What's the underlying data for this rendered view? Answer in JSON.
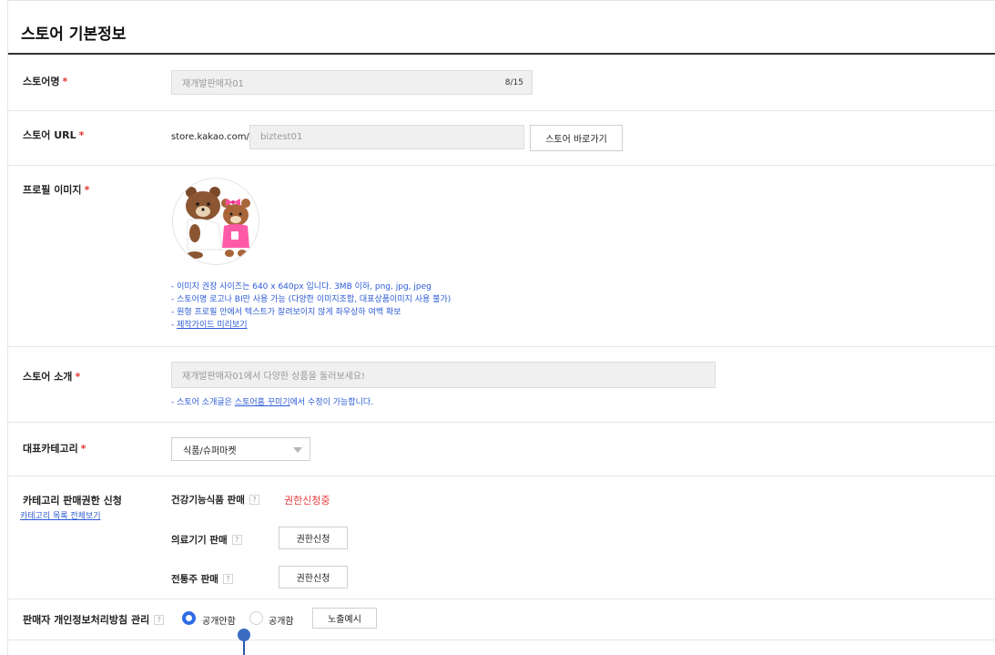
{
  "section_title": "스토어 기본정보",
  "required_mark": "*",
  "store_name": {
    "label": "스토어명",
    "value": "재개발판매자01",
    "counter": "8/15"
  },
  "store_url": {
    "label": "스토어 URL",
    "prefix": "store.kakao.com/",
    "value": "biztest01",
    "go_button": "스토어 바로가기"
  },
  "profile_image": {
    "label": "프로필 이미지",
    "notes": [
      "- 이미지 권장 사이즈는 640 x 640px 입니다. 3MB 이하, png, jpg, jpeg",
      "- 스토어명 로고나 BI만 사용 가능 (다양한 이미지조합, 대표상품이미지 사용 불가)",
      "- 원형 프로필 안에서 텍스트가 잘려보이지 않게 좌우상하 여백 확보"
    ],
    "guide_prefix": "- ",
    "guide_link": "제작가이드 미리보기"
  },
  "store_intro": {
    "label": "스토어 소개",
    "value": "재개발판매자01에서 다양한 상품을 둘러보세요!",
    "note_prefix": "- 스토어 소개글은 ",
    "note_link": "스토어홈 꾸미기",
    "note_suffix": "에서 수정이 가능합니다."
  },
  "category": {
    "label": "대표카테고리",
    "selected": "식품/슈퍼마켓"
  },
  "category_permission": {
    "label": "카테고리 판매권한 신청",
    "list_link": "카테고리 목록 전체보기",
    "help": "?",
    "items": [
      {
        "name": "건강기능식품 판매",
        "status": "권한신청중"
      },
      {
        "name": "의료기기 판매",
        "button": "권한신청"
      },
      {
        "name": "전통주 판매",
        "button": "권한신청"
      }
    ]
  },
  "privacy_policy": {
    "label": "판매자 개인정보처리방침 관리",
    "help": "?",
    "options": [
      "공개안함",
      "공개함"
    ],
    "selected_index": 0,
    "example_button": "노출예시"
  },
  "colors": {
    "accent": "#2e6be6",
    "required": "#e3342f",
    "note_blue": "#2d5bd6",
    "status_red": "#e83a3a"
  }
}
